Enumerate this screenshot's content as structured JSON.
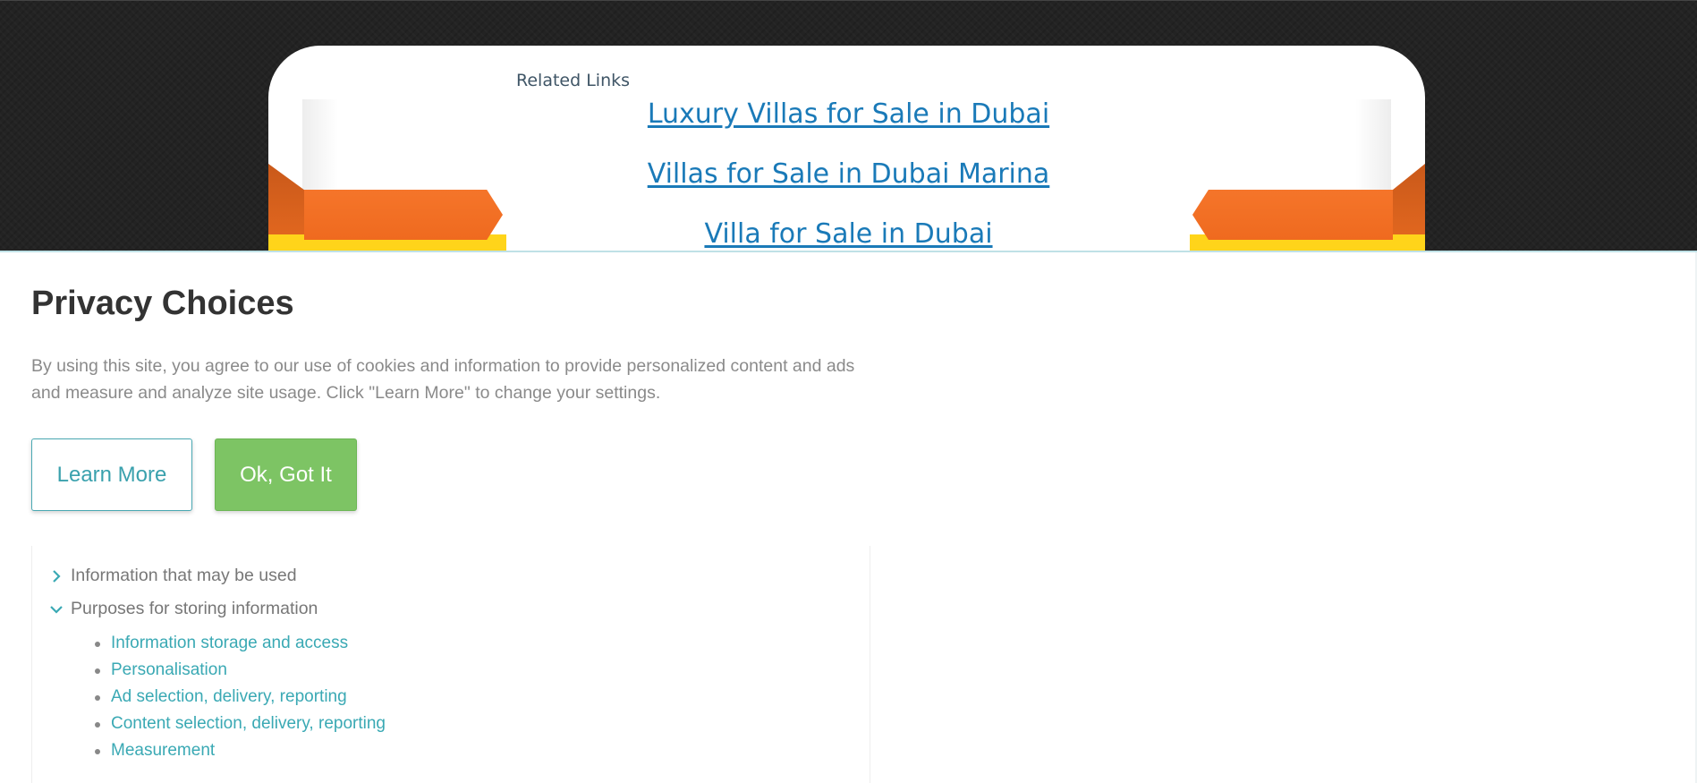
{
  "background_page": {
    "related_title": "Related Links",
    "links": [
      "Luxury Villas for Sale in Dubai",
      "Villas for Sale in Dubai Marina",
      "Villa for Sale in Dubai"
    ]
  },
  "privacy": {
    "title": "Privacy Choices",
    "description": "By using this site, you agree to our use of cookies and information to provide personalized content and ads and measure and analyze site usage. Click \"Learn More\" to change your settings.",
    "learn_more_label": "Learn More",
    "ok_label": "Ok, Got It",
    "sections": [
      {
        "label": "Information that may be used",
        "expanded": false,
        "icon": "chevron-right-icon"
      },
      {
        "label": "Purposes for storing information",
        "expanded": true,
        "icon": "chevron-down-icon"
      }
    ],
    "purposes": [
      "Information storage and access",
      "Personalisation",
      "Ad selection, delivery, reporting",
      "Content selection, delivery, reporting",
      "Measurement"
    ]
  },
  "colors": {
    "accent_teal": "#3aa9b4",
    "ok_green": "#7dc464",
    "link_blue": "#1a7ab8",
    "ribbon_orange": "#f5752a",
    "ribbon_yellow": "#ffd41a"
  }
}
